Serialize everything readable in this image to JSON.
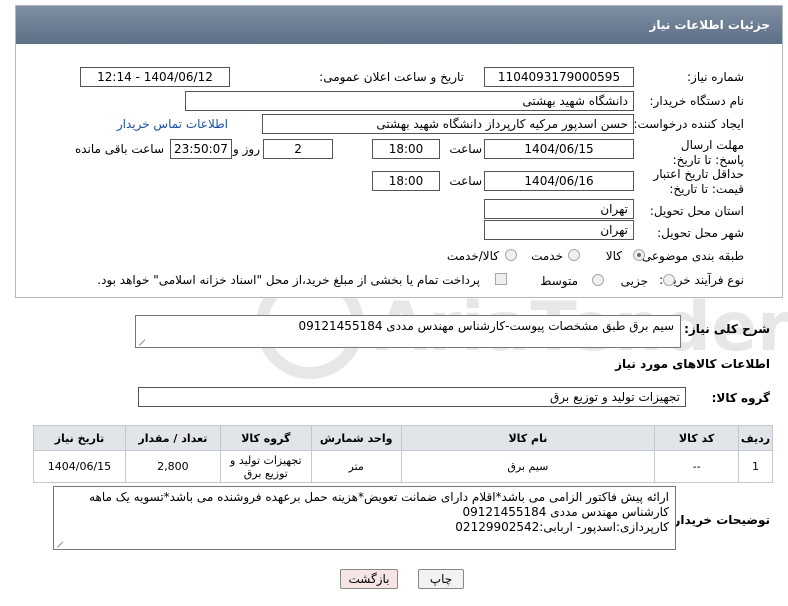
{
  "header": {
    "title": "جزئیات اطلاعات نیاز"
  },
  "form": {
    "need_number_label": "شماره نیاز:",
    "need_number": "1104093179000595",
    "announce_label": "تاریخ و ساعت اعلان عمومی:",
    "announce_value": "1404/06/12 - 12:14",
    "buyer_org_label": "نام دستگاه خریدار:",
    "buyer_org": "دانشگاه شهید بهشتی",
    "creator_label": "ایجاد کننده درخواست:",
    "creator": "حسن اسدپور مرکیه کارپرداز دانشگاه شهید بهشتی",
    "contact_link": "اطلاعات تماس خریدار",
    "reply_deadline_label": "مهلت ارسال پاسخ: تا تاریخ:",
    "reply_date": "1404/06/15",
    "time_label": "ساعت",
    "reply_time": "18:00",
    "days_value": "2",
    "days_label": "روز و",
    "remaining_time": "23:50:07",
    "remaining_label": "ساعت باقی مانده",
    "price_validity_label": "حداقل تاریخ اعتبار قیمت: تا تاریخ:",
    "price_date": "1404/06/16",
    "price_time": "18:00",
    "province_label": "استان محل تحویل:",
    "province": "تهران",
    "city_label": "شهر محل تحویل:",
    "city": "تهران",
    "category_label": "طبقه بندی موضوعی:",
    "category_options": [
      "کالا",
      "خدمت",
      "کالا/خدمت"
    ],
    "process_label": "نوع فرآیند خرید :",
    "process_options": [
      "جزیی",
      "متوسط"
    ],
    "payment_note": "پرداخت تمام یا بخشی از مبلغ خرید،از محل \"اسناد خزانه اسلامی\" خواهد بود."
  },
  "summary": {
    "label": "شرح کلی نیاز:",
    "text": "سیم برق طبق مشخصات پیوست-کارشناس مهندس مددی 09121455184"
  },
  "goods_section": {
    "title": "اطلاعات کالاهای مورد نیاز",
    "group_label": "گروه کالا:",
    "group_value": "تجهیزات تولید و توزیع برق"
  },
  "table": {
    "headers": [
      "ردیف",
      "کد کالا",
      "نام کالا",
      "واحد شمارش",
      "گروه کالا",
      "تعداد / مقدار",
      "تاریخ نیاز"
    ],
    "rows": [
      {
        "row": "1",
        "code": "--",
        "name": "سیم برق",
        "unit": "متر",
        "group": "تجهیزات تولید و توزیع برق",
        "qty": "2,800",
        "date": "1404/06/15"
      }
    ]
  },
  "buyer_notes": {
    "label": "توضیحات خریدار:",
    "line1": "ارائه پیش فاکتور الزامی می باشد*اقلام دارای ضمانت تعویض*هزینه حمل برعهده فروشنده می باشد*تسویه یک ماهه",
    "line2": "کارشناس مهندس مددی 09121455184",
    "line3": "کارپردازی:اسدپور- اربابی:02129902542"
  },
  "buttons": {
    "print": "چاپ",
    "back": "بازگشت"
  },
  "watermark": {
    "text": "AriaTender.net"
  },
  "colors": {
    "header_bg": "#6b7c92",
    "link": "#1a4fa8",
    "back_btn": "#f7e4e4"
  }
}
